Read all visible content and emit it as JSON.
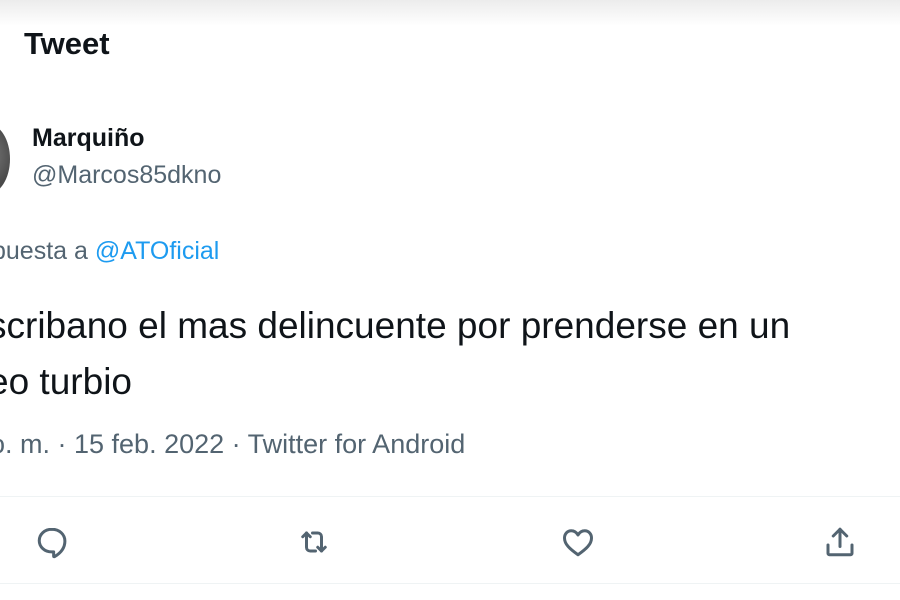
{
  "header": {
    "title": "Tweet"
  },
  "author": {
    "display_name": "Marquiño",
    "username": "@Marcos85dkno"
  },
  "reply": {
    "prefix": "puesta a",
    "mention": "@ATOficial"
  },
  "tweet": {
    "line1": "scribano el mas delincuente por prenderse en un",
    "line2": "eo turbio"
  },
  "meta": {
    "text": "o. m. · 15 feb. 2022 · Twitter for Android"
  },
  "actions": [
    {
      "icon": "reply-icon"
    },
    {
      "icon": "retweet-icon"
    },
    {
      "icon": "like-icon"
    },
    {
      "icon": "share-icon"
    }
  ]
}
